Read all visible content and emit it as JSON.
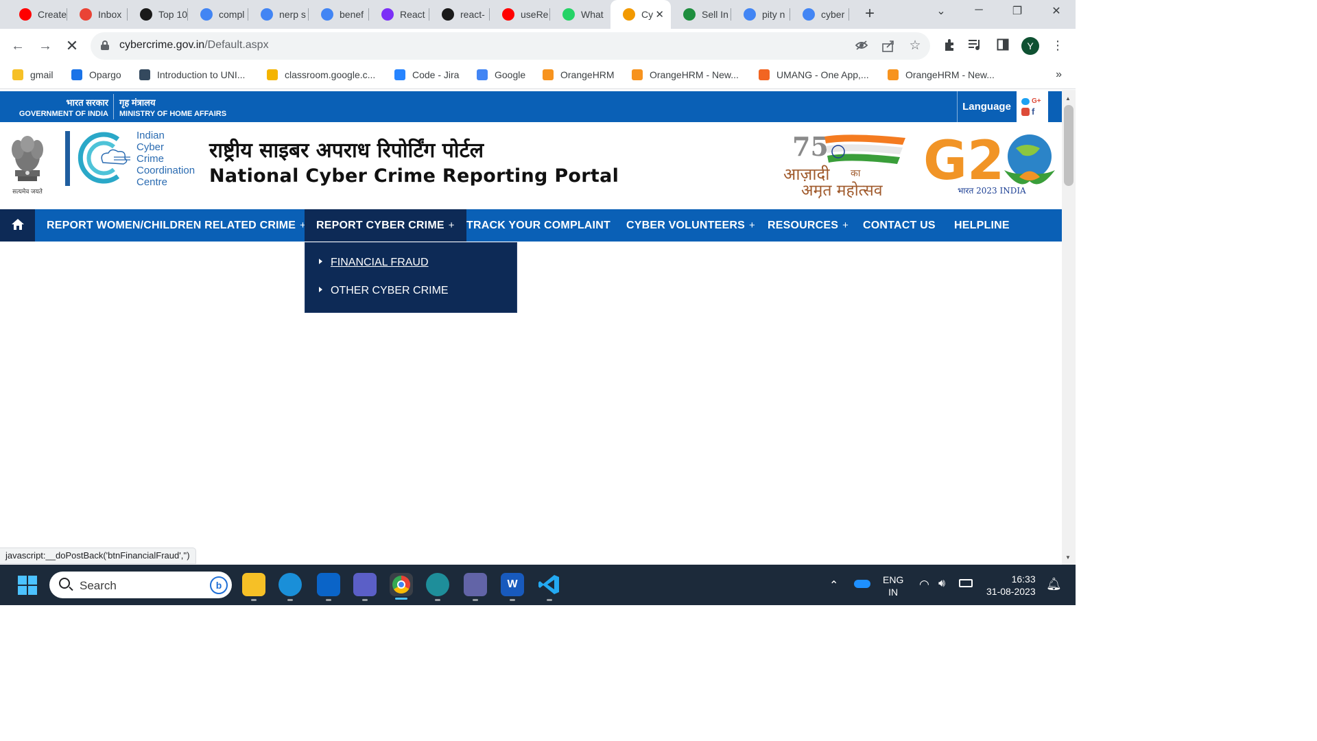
{
  "browser": {
    "tabs": [
      {
        "label": "Create",
        "icon": "youtube-icon",
        "color": "#ff0000"
      },
      {
        "label": "Inbox",
        "icon": "gmail-icon",
        "color": "#ea4335"
      },
      {
        "label": "Top 10",
        "icon": "sc-icon",
        "color": "#1a1a1a"
      },
      {
        "label": "compl",
        "icon": "google-icon",
        "color": "#4285f4"
      },
      {
        "label": "nerp s",
        "icon": "google-icon",
        "color": "#4285f4"
      },
      {
        "label": "benef",
        "icon": "google-icon",
        "color": "#4285f4"
      },
      {
        "label": "React",
        "icon": "react-course-icon",
        "color": "#7b2ff7"
      },
      {
        "label": "react-",
        "icon": "github-icon",
        "color": "#1a1a1a"
      },
      {
        "label": "useRe",
        "icon": "youtube-icon",
        "color": "#ff0000"
      },
      {
        "label": "What",
        "icon": "whatsapp-icon",
        "color": "#25d366"
      },
      {
        "label": "Cy",
        "icon": "cybercrime-icon",
        "color": "#f29900",
        "active": true
      },
      {
        "label": "Sell In",
        "icon": "shield-icon",
        "color": "#1e8e3e"
      },
      {
        "label": "pity n",
        "icon": "google-icon",
        "color": "#4285f4"
      },
      {
        "label": "cyber",
        "icon": "google-icon",
        "color": "#4285f4"
      }
    ],
    "url_domain": "cybercrime.gov.in",
    "url_path": "/Default.aspx",
    "profile_initial": "Y",
    "bookmarks": [
      {
        "label": "gmail",
        "color": "#f6c026"
      },
      {
        "label": "Opargo",
        "color": "#1a73e8"
      },
      {
        "label": "Introduction to UNI...",
        "color": "#34495e"
      },
      {
        "label": "classroom.google.c...",
        "color": "#f4b400"
      },
      {
        "label": "Code - Jira",
        "color": "#2684ff"
      },
      {
        "label": "Google",
        "color": "#4285f4"
      },
      {
        "label": "OrangeHRM",
        "color": "#f7931e"
      },
      {
        "label": "OrangeHRM - New...",
        "color": "#f7931e"
      },
      {
        "label": "UMANG - One App,...",
        "color": "#f26522"
      },
      {
        "label": "OrangeHRM - New...",
        "color": "#f7931e"
      }
    ],
    "bookmarks_more": "»",
    "status_url": "javascript:__doPostBack('btnFinancialFraud','')"
  },
  "site": {
    "gov_hi": "भारत सरकार",
    "gov_en": "GOVERNMENT OF INDIA",
    "ministry_hi": "गृह मंत्रालय",
    "ministry_en": "MINISTRY OF HOME AFFAIRS",
    "language_label": "Language",
    "emblem_tagline": "सत्यमेव जयते",
    "i4c_lines": [
      "Indian",
      "Cyber",
      "Crime",
      "Coordination",
      "Centre"
    ],
    "title_hi": "राष्ट्रीय साइबर अपराध रिपोर्टिंग पोर्टल",
    "title_en": "National Cyber Crime Reporting Portal",
    "azadi_hi_line1": "आज़ादी",
    "azadi_hi_ka": "का",
    "azadi_hi_line2": "अमृत महोत्सव",
    "g20_year": "भारत 2023 INDIA",
    "nav": [
      {
        "label": "REPORT WOMEN/CHILDREN RELATED CRIME",
        "has_plus": true
      },
      {
        "label": "REPORT CYBER CRIME",
        "has_plus": true,
        "active": true
      },
      {
        "label": "TRACK YOUR COMPLAINT",
        "has_plus": false
      },
      {
        "label": "CYBER VOLUNTEERS",
        "has_plus": true
      },
      {
        "label": "RESOURCES",
        "has_plus": true
      },
      {
        "label": "CONTACT US",
        "has_plus": false
      },
      {
        "label": "HELPLINE",
        "has_plus": false
      }
    ],
    "plus_symbol": "+",
    "dropdown": [
      {
        "label": "FINANCIAL FRAUD",
        "hover": true
      },
      {
        "label": "OTHER CYBER CRIME",
        "hover": false
      }
    ],
    "colors": {
      "nav_blue": "#0a60b6",
      "nav_dark": "#0d2a56"
    }
  },
  "taskbar": {
    "search_placeholder": "Search",
    "lang_line1": "ENG",
    "lang_line2": "IN",
    "time": "16:33",
    "date": "31-08-2023"
  }
}
